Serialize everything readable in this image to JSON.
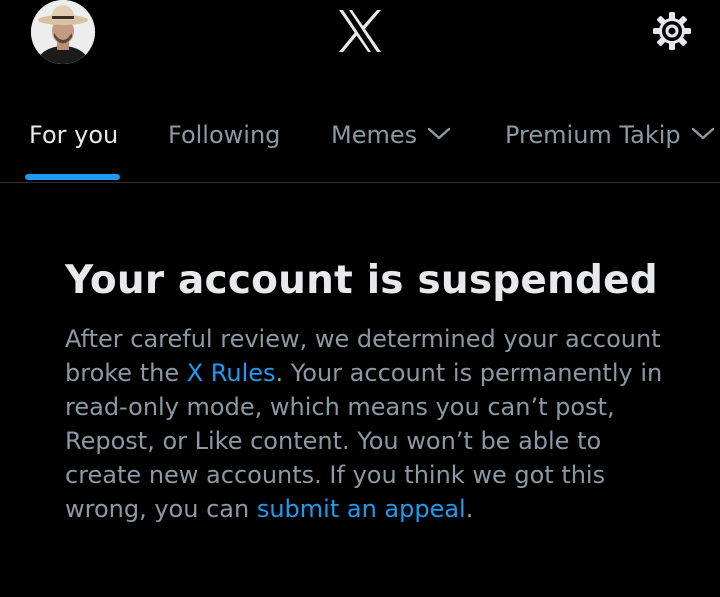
{
  "header": {
    "avatar_icon": "profile-avatar",
    "logo_icon": "x-logo-icon",
    "settings_icon": "gear-icon"
  },
  "tabs": [
    {
      "label": "For you",
      "active": true
    },
    {
      "label": "Following",
      "active": false
    },
    {
      "label": "Memes",
      "active": false,
      "dropdown": true
    },
    {
      "label": "Premium Takip",
      "active": false,
      "dropdown": true
    }
  ],
  "notice": {
    "title": "Your account is suspended",
    "text_1": "After careful review, we determined your account broke the ",
    "rules_link": "X Rules",
    "text_2": ". Your account is permanently in read-only mode, which means you can’t post, Repost, or Like content. You won’t be able to create new accounts. If you think we got this wrong, you can ",
    "appeal_link": "submit an appeal",
    "text_3": "."
  },
  "colors": {
    "background": "#000000",
    "primary_text": "#e7e9ea",
    "secondary_text": "#8b98a5",
    "accent": "#1d9bf0",
    "divider": "#2f3336"
  }
}
